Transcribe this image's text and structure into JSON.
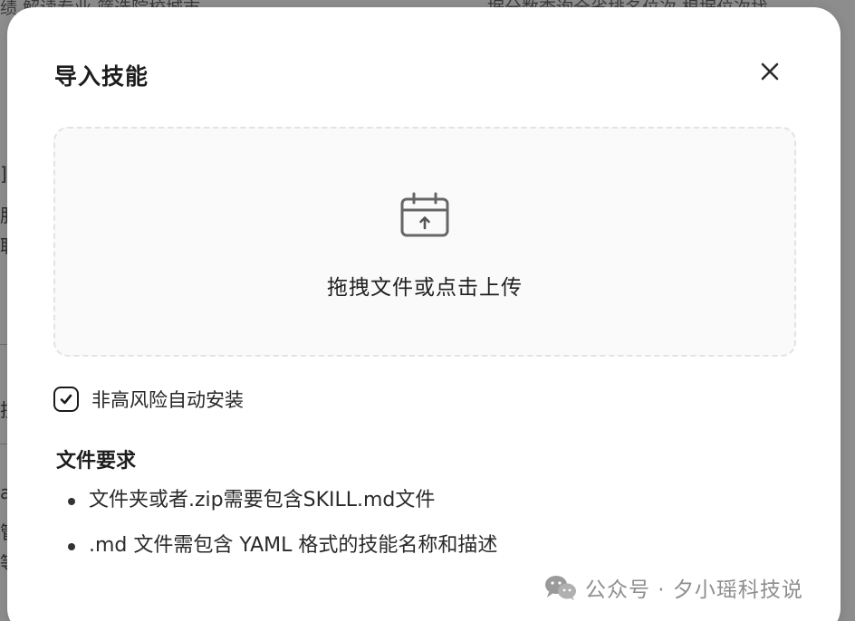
{
  "background": {
    "top_left_text": "绩  解读专业  筛选院校城市",
    "top_right_text": "据分数查询全省排名位次  根据位次找",
    "left_fragments": [
      "]",
      "服",
      "职",
      "技",
      "a",
      "管",
      "等"
    ]
  },
  "modal": {
    "title": "导入技能",
    "close_icon": "close-icon",
    "dropzone": {
      "icon": "calendar-upload-icon",
      "text": "拖拽文件或点击上传"
    },
    "checkbox": {
      "checked": true,
      "label": "非高风险自动安装"
    },
    "requirements": {
      "title": "文件要求",
      "items": [
        "文件夹或者.zip需要包含SKILL.md文件",
        ".md 文件需包含 YAML 格式的技能名称和描述"
      ]
    }
  },
  "watermark": {
    "icon": "wechat-icon",
    "text": "公众号 · 夕小瑶科技说"
  },
  "colors": {
    "overlay": "#8d8d8d",
    "modal_bg": "#ffffff",
    "dropzone_border": "#e3e3e3",
    "text_primary": "#1d1d1d",
    "watermark": "#8e8e8e"
  }
}
